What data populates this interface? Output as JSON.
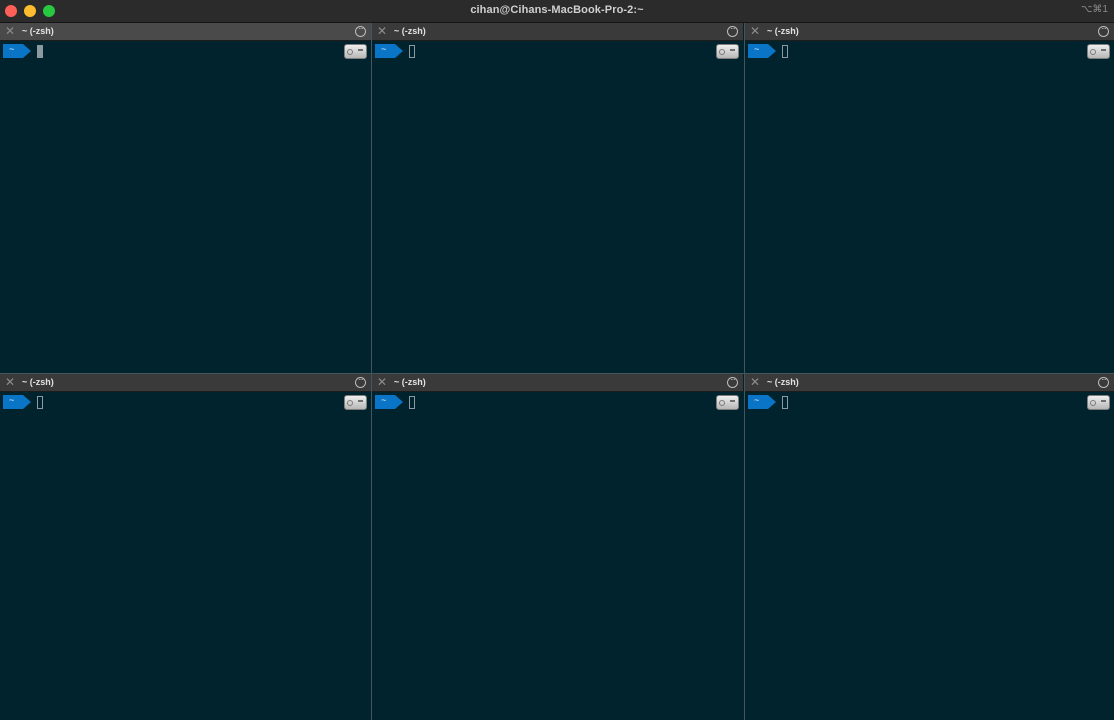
{
  "window": {
    "title": "cihan@Cihans-MacBook-Pro-2:~",
    "shortcut": "⌥⌘1"
  },
  "panes": [
    {
      "title": "~ (-zsh)",
      "prompt": "~",
      "cursor_style": "block"
    },
    {
      "title": "~ (-zsh)",
      "prompt": "~",
      "cursor_style": "outline"
    },
    {
      "title": "~ (-zsh)",
      "prompt": "~",
      "cursor_style": "outline"
    },
    {
      "title": "~ (-zsh)",
      "prompt": "~",
      "cursor_style": "outline"
    },
    {
      "title": "~ (-zsh)",
      "prompt": "~",
      "cursor_style": "outline"
    },
    {
      "title": "~ (-zsh)",
      "prompt": "~",
      "cursor_style": "outline"
    }
  ],
  "icons": {
    "close": "close-icon",
    "pane_menu": "ellipsis-circle-icon",
    "prompt_badge": "prompt-arrow-icon",
    "drive": "drive-icon"
  },
  "colors": {
    "terminal_background": "#00232e",
    "prompt_blue": "#0a74c7",
    "titlebar": "#2b2b2b"
  }
}
